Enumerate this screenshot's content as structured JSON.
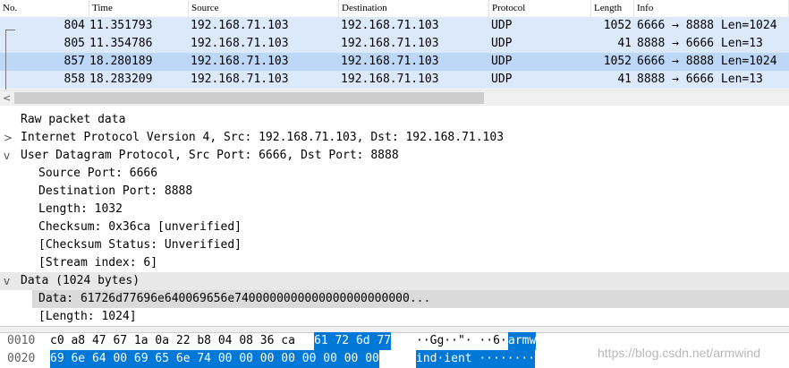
{
  "columns": {
    "no": "No.",
    "time": "Time",
    "source": "Source",
    "destination": "Destination",
    "protocol": "Protocol",
    "length": "Length",
    "info": "Info"
  },
  "packets": [
    {
      "no": "804",
      "time": "11.351793",
      "source": "192.168.71.103",
      "destination": "192.168.71.103",
      "protocol": "UDP",
      "length": "1052",
      "info": "6666 → 8888 Len=1024",
      "bg": "#dbe9fb"
    },
    {
      "no": "805",
      "time": "11.354786",
      "source": "192.168.71.103",
      "destination": "192.168.71.103",
      "protocol": "UDP",
      "length": "41",
      "info": "8888 → 6666 Len=13",
      "bg": "#dbe9fb"
    },
    {
      "no": "857",
      "time": "18.280189",
      "source": "192.168.71.103",
      "destination": "192.168.71.103",
      "protocol": "UDP",
      "length": "1052",
      "info": "6666 → 8888 Len=1024",
      "bg": "#bcd8f6"
    },
    {
      "no": "858",
      "time": "18.283209",
      "source": "192.168.71.103",
      "destination": "192.168.71.103",
      "protocol": "UDP",
      "length": "41",
      "info": "8888 → 6666 Len=13",
      "bg": "#dbe9fb"
    }
  ],
  "scrollbar": {
    "left_arrow": "<"
  },
  "details": {
    "raw": "Raw packet data",
    "ip": "Internet Protocol Version 4, Src: 192.168.71.103, Dst: 192.168.71.103",
    "udp": "User Datagram Protocol, Src Port: 6666, Dst Port: 8888",
    "udp_fields": {
      "src_port": "Source Port: 6666",
      "dst_port": "Destination Port: 8888",
      "length": "Length: 1032",
      "checksum": "Checksum: 0x36ca [unverified]",
      "checksum_status": "[Checksum Status: Unverified]",
      "stream_index": "[Stream index: 6]"
    },
    "data": "Data (1024 bytes)",
    "data_fields": {
      "data": "Data: 61726d77696e640069656e7400000000000000000000000...",
      "length": "[Length: 1024]"
    },
    "arrow_collapsed": ">",
    "arrow_expanded": "v"
  },
  "hex": [
    {
      "offset": "0010",
      "plain": "c0 a8 47 67 1a 0a 22 b8  04 08 36 ca",
      "sel": "61 72 6d 77",
      "ascii_plain": "··Gg··\"·  ··6·",
      "ascii_sel": "armw"
    },
    {
      "offset": "0020",
      "plain": "",
      "sel": "69 6e 64 00 69 65 6e 74  00 00 00 00 00 00 00 00",
      "ascii_plain": "",
      "ascii_sel": "ind·ient ········"
    }
  ],
  "watermark": "https://blog.csdn.net/armwind",
  "colors": {
    "selection": "#0078d7",
    "row_light": "#dbe9fb",
    "row_selected": "#bcd8f6",
    "data_highlight": "#e8e8e8"
  }
}
